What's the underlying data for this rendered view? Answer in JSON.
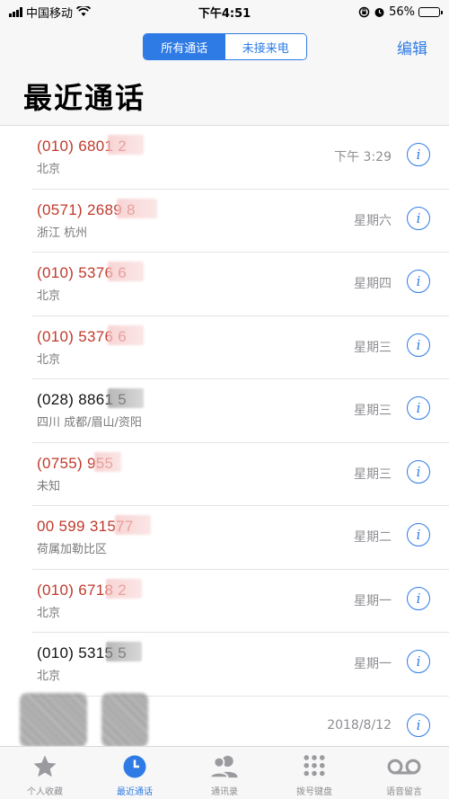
{
  "status_bar": {
    "carrier": "中国移动",
    "time": "下午4:51",
    "battery_percent": "56%",
    "battery_level": 0.56
  },
  "nav": {
    "segments": [
      "所有通话",
      "未接来电"
    ],
    "selected_segment": 0,
    "edit_label": "编辑",
    "title": "最近通话"
  },
  "calls": [
    {
      "number": "(010) 6801 2",
      "location": "北京",
      "time": "下午 3:29",
      "missed": true
    },
    {
      "number": "(0571) 2689 8",
      "location": "浙江 杭州",
      "time": "星期六",
      "missed": true
    },
    {
      "number": "(010) 5376 6",
      "location": "北京",
      "time": "星期四",
      "missed": true
    },
    {
      "number": "(010) 5376 6",
      "location": "北京",
      "time": "星期三",
      "missed": true
    },
    {
      "number": "(028) 8861 5",
      "location": "四川 成都/眉山/资阳",
      "time": "星期三",
      "missed": false
    },
    {
      "number": "(0755) 955",
      "location": "未知",
      "time": "星期三",
      "missed": true
    },
    {
      "number": "00 599 31577",
      "location": "荷属加勒比区",
      "time": "星期二",
      "missed": true
    },
    {
      "number": "(010) 6718 2",
      "location": "北京",
      "time": "星期一",
      "missed": true
    },
    {
      "number": "(010) 5315 5",
      "location": "北京",
      "time": "星期一",
      "missed": false
    },
    {
      "number": "",
      "location": "",
      "time": "2018/8/12",
      "missed": false
    }
  ],
  "tabs": [
    {
      "label": "个人收藏",
      "icon": "star-icon"
    },
    {
      "label": "最近通话",
      "icon": "clock-icon"
    },
    {
      "label": "通讯录",
      "icon": "contacts-icon"
    },
    {
      "label": "拨号键盘",
      "icon": "keypad-icon"
    },
    {
      "label": "语音留言",
      "icon": "voicemail-icon"
    }
  ],
  "active_tab": 1,
  "colors": {
    "accent": "#2f7be5",
    "missed": "#c0392b"
  }
}
